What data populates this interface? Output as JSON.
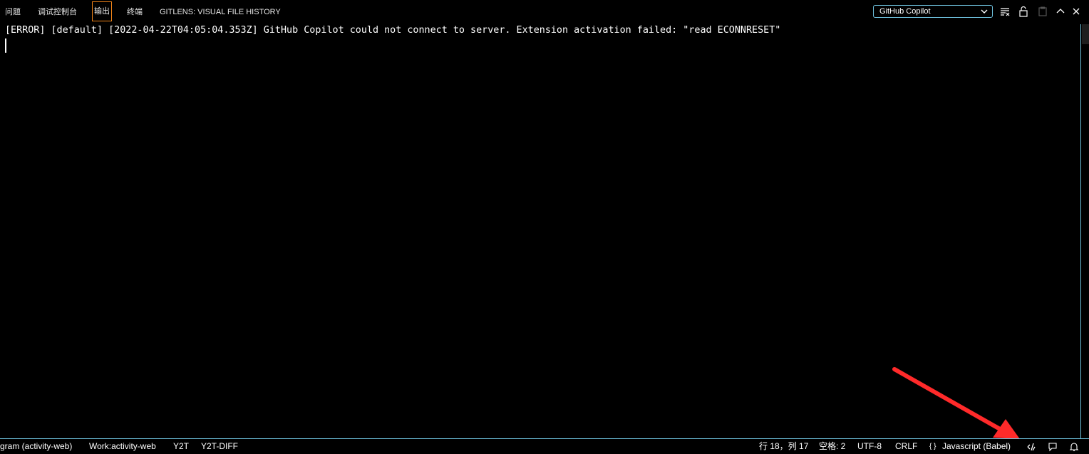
{
  "panel": {
    "tabs": [
      {
        "label": "问题"
      },
      {
        "label": "调试控制台"
      },
      {
        "label": "输出"
      },
      {
        "label": "终端"
      },
      {
        "label": "GITLENS: VISUAL FILE HISTORY"
      }
    ],
    "active_tab": "输出",
    "channel_select": {
      "value": "GitHub Copilot"
    },
    "actions": [
      "clear-output-icon",
      "lock-scroll-icon",
      "open-log-icon",
      "maximize-panel-icon",
      "close-panel-icon"
    ]
  },
  "output": {
    "lines": [
      "[ERROR] [default] [2022-04-22T04:05:04.353Z] GitHub Copilot could not connect to server. Extension activation failed: \"read ECONNRESET\""
    ]
  },
  "statusbar": {
    "left": [
      {
        "label": "gram (activity-web)"
      },
      {
        "label": "Work:activity-web"
      },
      {
        "label": "Y2T"
      },
      {
        "label": "Y2T-DIFF"
      }
    ],
    "right": {
      "position": "行 18，列 17",
      "indent": "空格: 2",
      "encoding": "UTF-8",
      "eol": "CRLF",
      "language_icon": "{ }",
      "language": "Javascript (Babel)",
      "icons": [
        "copilot-icon",
        "feedback-icon",
        "bell-icon"
      ]
    }
  },
  "colors": {
    "background": "#000000",
    "contrast_border": "#6fc3df",
    "active_tab_border": "#f38518",
    "annotation_arrow": "#ff2a2a"
  }
}
